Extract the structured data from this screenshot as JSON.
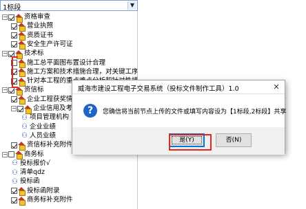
{
  "combo": {
    "value": "1标段"
  },
  "tree": [
    {
      "label": "资格审查",
      "expander": "−",
      "checkbox": "on",
      "icon": "house-icon",
      "level": 0
    },
    {
      "label": "营业执照",
      "checkbox": "on",
      "icon": "house-icon",
      "level": 1
    },
    {
      "label": "资质证书",
      "checkbox": "on",
      "icon": "house-icon",
      "level": 1
    },
    {
      "label": "安全生产许可证",
      "checkbox": "on",
      "icon": "house-icon",
      "level": 1
    },
    {
      "label": "技术标",
      "expander": "−",
      "checkbox": "on",
      "icon": "house-icon",
      "level": 0
    },
    {
      "label": "施工总平面图布置设计合理",
      "checkbox": "off",
      "icon": "house-icon",
      "level": 1
    },
    {
      "label": "施工方案和技术措施合理，对关键工序有针",
      "checkbox": "on",
      "icon": "house-icon",
      "level": 1
    },
    {
      "label": "针对本工程的重点难点分析和针对性措施",
      "checkbox": "on",
      "icon": "house-icon",
      "level": 1
    },
    {
      "label": "资信标",
      "expander": "−",
      "checkbox": "on",
      "icon": "house-icon",
      "level": 0
    },
    {
      "label": "企业工程获奖情况",
      "checkbox": "on",
      "icon": "house-icon",
      "level": 1
    },
    {
      "label": "企业信用及考核",
      "expander": "−",
      "checkbox": "on",
      "icon": "house-icon",
      "level": 1
    },
    {
      "label": "项目管理机构",
      "icon": "people-icon",
      "level": 2
    },
    {
      "label": "企业业绩",
      "icon": "people-icon",
      "level": 2
    },
    {
      "label": "人员业绩",
      "icon": "people-icon",
      "level": 2
    },
    {
      "label": "资信标补充附件",
      "checkbox": "on",
      "icon": "house-icon",
      "level": 1
    },
    {
      "label": "商务标",
      "expander": "−",
      "checkbox": "off",
      "icon": "house-icon",
      "level": 0
    },
    {
      "label": "投标报价√",
      "icon": "people-icon",
      "level": 1
    },
    {
      "label": "清单qdz",
      "icon": "people-icon",
      "level": 1
    },
    {
      "label": "投标函",
      "icon": "people-icon",
      "level": 1
    },
    {
      "label": "投标函附录",
      "checkbox": "on",
      "icon": "house-icon",
      "level": 1
    },
    {
      "label": "商务标补充附件",
      "checkbox": "on",
      "icon": "house-icon",
      "level": 1
    }
  ],
  "dialog": {
    "title": "威海市建设工程电子交易系统（投标文件制作工具）1.0",
    "message": "您确信将当前节点上传的文件或填写内容设为【1标段,2标段】共享",
    "yes": "是(Y)",
    "no": "否(N)",
    "close": "✕",
    "icon": "question-icon"
  },
  "colors": {
    "highlight": "#e4241b",
    "accent": "#0078d7"
  }
}
